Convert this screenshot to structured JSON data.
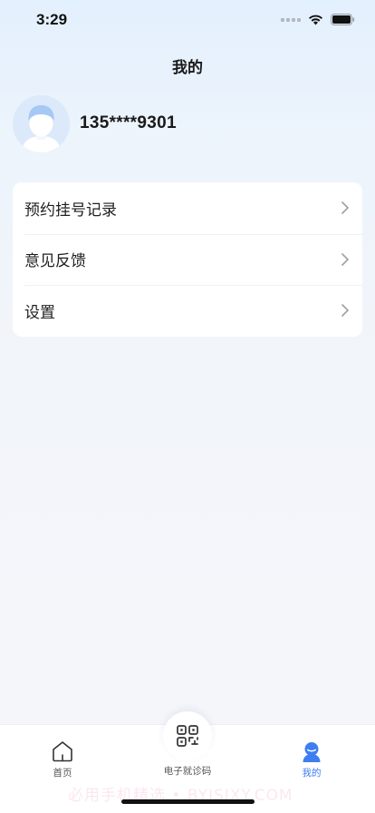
{
  "status_bar": {
    "time": "3:29"
  },
  "header": {
    "title": "我的"
  },
  "profile": {
    "phone": "135****9301"
  },
  "menu": {
    "items": [
      {
        "label": "预约挂号记录"
      },
      {
        "label": "意见反馈"
      },
      {
        "label": "设置"
      }
    ]
  },
  "tabbar": {
    "home_label": "首页",
    "center_label": "电子就诊码",
    "mine_label": "我的",
    "active_color": "#3f7ef0"
  },
  "watermark": {
    "text": "必用手机精选 • BYJSJXY.COM"
  }
}
